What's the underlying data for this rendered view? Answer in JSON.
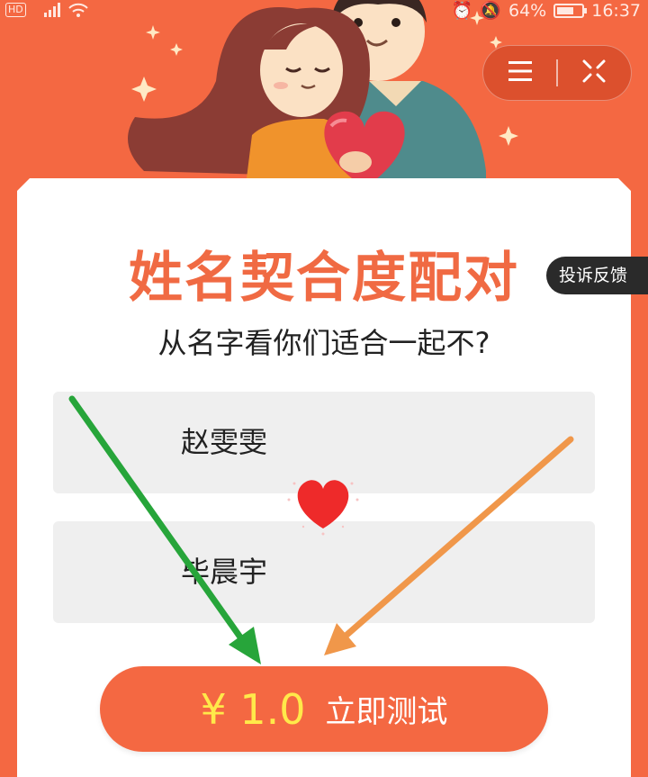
{
  "status_bar": {
    "hd": "HD",
    "signal_label": "4G",
    "battery": "64%",
    "time": "16:37"
  },
  "capsule": {
    "menu_icon": "menu-icon",
    "close_icon": "close-target-icon"
  },
  "card": {
    "title": "姓名契合度配对",
    "subtitle": "从名字看你们适合一起不?"
  },
  "complaint": {
    "label": "投诉反馈"
  },
  "names": {
    "first": "赵雯雯",
    "second": "毕晨宇"
  },
  "heart": {
    "icon": "heart-icon"
  },
  "action": {
    "price": "¥ 1.0",
    "label": "立即测试"
  },
  "colors": {
    "background": "#f46842",
    "title": "#f06a43",
    "price": "#ffe94a",
    "arrow_left": "#27a53a",
    "arrow_right": "#f0974a",
    "heart": "#ee2a2a"
  }
}
